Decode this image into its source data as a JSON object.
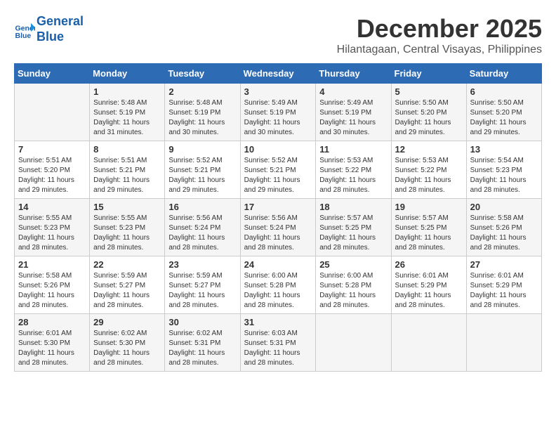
{
  "logo": {
    "line1": "General",
    "line2": "Blue"
  },
  "title": "December 2025",
  "location": "Hilantagaan, Central Visayas, Philippines",
  "days_header": [
    "Sunday",
    "Monday",
    "Tuesday",
    "Wednesday",
    "Thursday",
    "Friday",
    "Saturday"
  ],
  "weeks": [
    [
      {
        "day": "",
        "info": ""
      },
      {
        "day": "1",
        "info": "Sunrise: 5:48 AM\nSunset: 5:19 PM\nDaylight: 11 hours\nand 31 minutes."
      },
      {
        "day": "2",
        "info": "Sunrise: 5:48 AM\nSunset: 5:19 PM\nDaylight: 11 hours\nand 30 minutes."
      },
      {
        "day": "3",
        "info": "Sunrise: 5:49 AM\nSunset: 5:19 PM\nDaylight: 11 hours\nand 30 minutes."
      },
      {
        "day": "4",
        "info": "Sunrise: 5:49 AM\nSunset: 5:19 PM\nDaylight: 11 hours\nand 30 minutes."
      },
      {
        "day": "5",
        "info": "Sunrise: 5:50 AM\nSunset: 5:20 PM\nDaylight: 11 hours\nand 29 minutes."
      },
      {
        "day": "6",
        "info": "Sunrise: 5:50 AM\nSunset: 5:20 PM\nDaylight: 11 hours\nand 29 minutes."
      }
    ],
    [
      {
        "day": "7",
        "info": "Sunrise: 5:51 AM\nSunset: 5:20 PM\nDaylight: 11 hours\nand 29 minutes."
      },
      {
        "day": "8",
        "info": "Sunrise: 5:51 AM\nSunset: 5:21 PM\nDaylight: 11 hours\nand 29 minutes."
      },
      {
        "day": "9",
        "info": "Sunrise: 5:52 AM\nSunset: 5:21 PM\nDaylight: 11 hours\nand 29 minutes."
      },
      {
        "day": "10",
        "info": "Sunrise: 5:52 AM\nSunset: 5:21 PM\nDaylight: 11 hours\nand 29 minutes."
      },
      {
        "day": "11",
        "info": "Sunrise: 5:53 AM\nSunset: 5:22 PM\nDaylight: 11 hours\nand 28 minutes."
      },
      {
        "day": "12",
        "info": "Sunrise: 5:53 AM\nSunset: 5:22 PM\nDaylight: 11 hours\nand 28 minutes."
      },
      {
        "day": "13",
        "info": "Sunrise: 5:54 AM\nSunset: 5:23 PM\nDaylight: 11 hours\nand 28 minutes."
      }
    ],
    [
      {
        "day": "14",
        "info": "Sunrise: 5:55 AM\nSunset: 5:23 PM\nDaylight: 11 hours\nand 28 minutes."
      },
      {
        "day": "15",
        "info": "Sunrise: 5:55 AM\nSunset: 5:23 PM\nDaylight: 11 hours\nand 28 minutes."
      },
      {
        "day": "16",
        "info": "Sunrise: 5:56 AM\nSunset: 5:24 PM\nDaylight: 11 hours\nand 28 minutes."
      },
      {
        "day": "17",
        "info": "Sunrise: 5:56 AM\nSunset: 5:24 PM\nDaylight: 11 hours\nand 28 minutes."
      },
      {
        "day": "18",
        "info": "Sunrise: 5:57 AM\nSunset: 5:25 PM\nDaylight: 11 hours\nand 28 minutes."
      },
      {
        "day": "19",
        "info": "Sunrise: 5:57 AM\nSunset: 5:25 PM\nDaylight: 11 hours\nand 28 minutes."
      },
      {
        "day": "20",
        "info": "Sunrise: 5:58 AM\nSunset: 5:26 PM\nDaylight: 11 hours\nand 28 minutes."
      }
    ],
    [
      {
        "day": "21",
        "info": "Sunrise: 5:58 AM\nSunset: 5:26 PM\nDaylight: 11 hours\nand 28 minutes."
      },
      {
        "day": "22",
        "info": "Sunrise: 5:59 AM\nSunset: 5:27 PM\nDaylight: 11 hours\nand 28 minutes."
      },
      {
        "day": "23",
        "info": "Sunrise: 5:59 AM\nSunset: 5:27 PM\nDaylight: 11 hours\nand 28 minutes."
      },
      {
        "day": "24",
        "info": "Sunrise: 6:00 AM\nSunset: 5:28 PM\nDaylight: 11 hours\nand 28 minutes."
      },
      {
        "day": "25",
        "info": "Sunrise: 6:00 AM\nSunset: 5:28 PM\nDaylight: 11 hours\nand 28 minutes."
      },
      {
        "day": "26",
        "info": "Sunrise: 6:01 AM\nSunset: 5:29 PM\nDaylight: 11 hours\nand 28 minutes."
      },
      {
        "day": "27",
        "info": "Sunrise: 6:01 AM\nSunset: 5:29 PM\nDaylight: 11 hours\nand 28 minutes."
      }
    ],
    [
      {
        "day": "28",
        "info": "Sunrise: 6:01 AM\nSunset: 5:30 PM\nDaylight: 11 hours\nand 28 minutes."
      },
      {
        "day": "29",
        "info": "Sunrise: 6:02 AM\nSunset: 5:30 PM\nDaylight: 11 hours\nand 28 minutes."
      },
      {
        "day": "30",
        "info": "Sunrise: 6:02 AM\nSunset: 5:31 PM\nDaylight: 11 hours\nand 28 minutes."
      },
      {
        "day": "31",
        "info": "Sunrise: 6:03 AM\nSunset: 5:31 PM\nDaylight: 11 hours\nand 28 minutes."
      },
      {
        "day": "",
        "info": ""
      },
      {
        "day": "",
        "info": ""
      },
      {
        "day": "",
        "info": ""
      }
    ]
  ]
}
